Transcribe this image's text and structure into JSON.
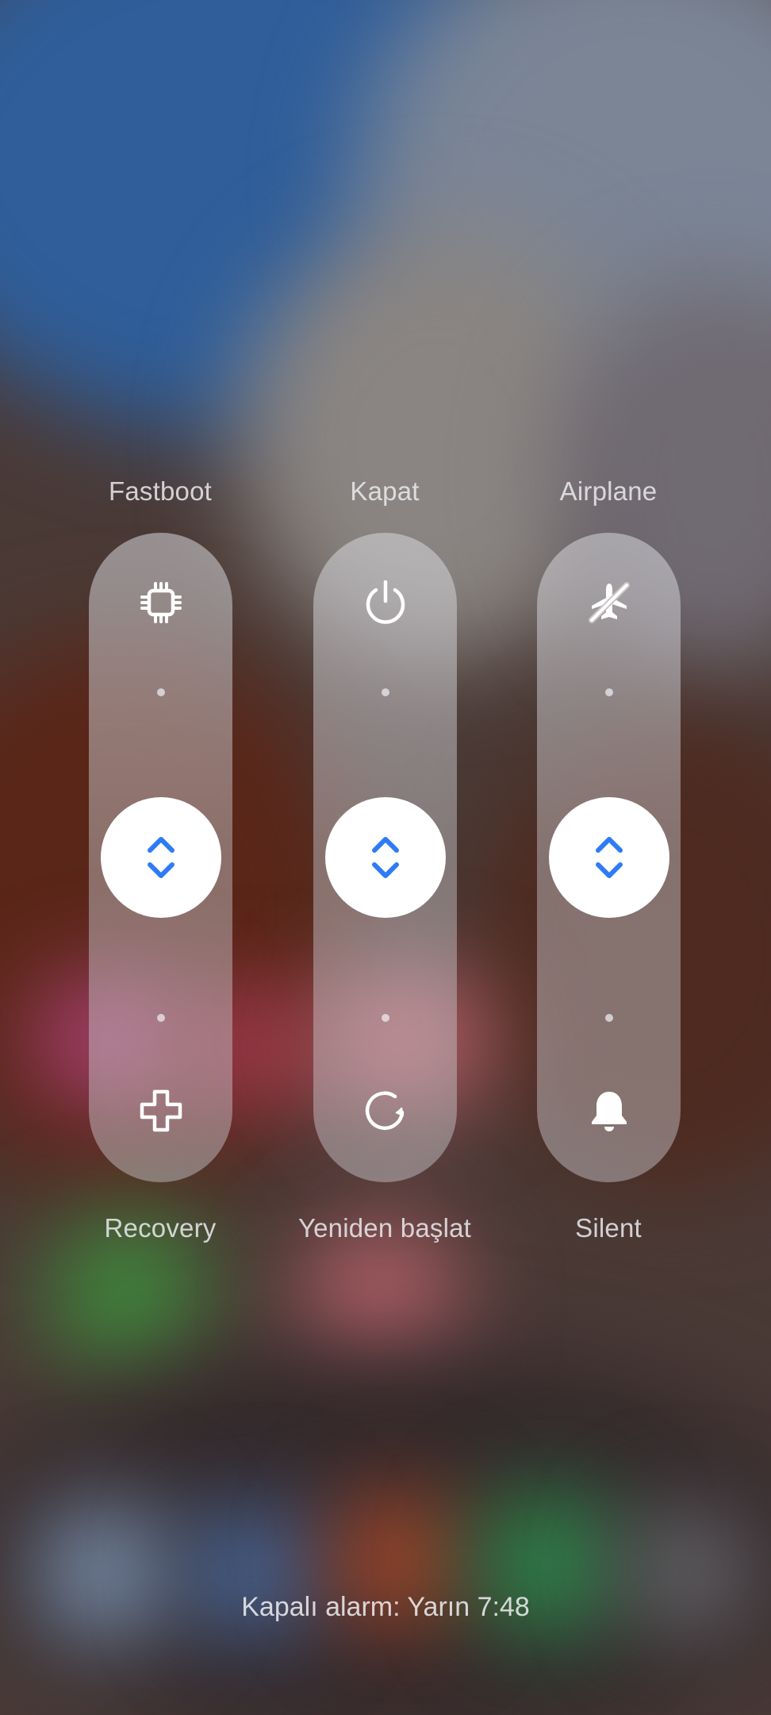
{
  "columns": [
    {
      "top_label": "Fastboot",
      "bottom_label": "Recovery",
      "top_icon": "chip-icon",
      "bottom_icon": "plus-icon"
    },
    {
      "top_label": "Kapat",
      "bottom_label": "Yeniden başlat",
      "top_icon": "power-icon",
      "bottom_icon": "restart-icon"
    },
    {
      "top_label": "Airplane",
      "bottom_label": "Silent",
      "top_icon": "airplane-off-icon",
      "bottom_icon": "bell-icon"
    }
  ],
  "slider_icon": "chevron-up-down-icon",
  "alarm_text": "Kapalı alarm: Yarın 7:48",
  "colors": {
    "accent": "#2f7bf5",
    "knob": "#ffffff",
    "icon": "#ffffff"
  }
}
